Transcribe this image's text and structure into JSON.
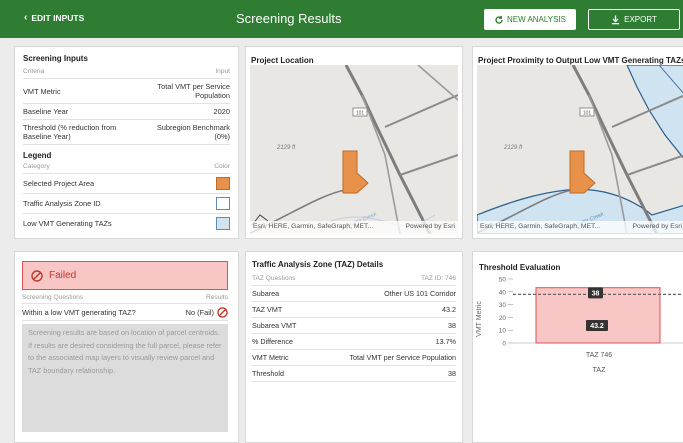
{
  "header": {
    "back_label": "EDIT INPUTS",
    "title": "Screening Results",
    "new_analysis_label": "NEW ANALYSIS",
    "export_label": "EXPORT"
  },
  "screening_inputs": {
    "title": "Screening Inputs",
    "col_criteria": "Criteria",
    "col_input": "Input",
    "rows": [
      {
        "label": "VMT Metric",
        "value": "Total VMT per Service Population"
      },
      {
        "label": "Baseline Year",
        "value": "2020"
      },
      {
        "label": "Threshold (% reduction from Baseline Year)",
        "value": "Subregion Benchmark (0%)"
      }
    ]
  },
  "legend": {
    "title": "Legend",
    "col_category": "Category",
    "col_color": "Color",
    "items": [
      {
        "label": "Selected Project Area",
        "color": "#e8914a"
      },
      {
        "label": "Traffic Analysis Zone ID",
        "color": "#ffffff"
      },
      {
        "label": "Low VMT Generating TAZs",
        "color": "#cfe3f1"
      }
    ]
  },
  "map1": {
    "title": "Project Location",
    "elevation": "2129 ft",
    "route": "101",
    "creek": "Mettin Creek",
    "attribution": "Esri, HERE, Garmin, SafeGraph, MET...",
    "powered": "Powered by Esri"
  },
  "map2": {
    "title": "Project Proximity to Output Low VMT Generating TAZs",
    "elevation": "2129 ft",
    "route": "101",
    "creek": "Mettin Creek",
    "attribution": "Esri, HERE, Garmin, SafeGraph, MET...",
    "powered": "Powered by Esri"
  },
  "result": {
    "status": "Failed",
    "col_questions": "Screening Questions",
    "col_results": "Results",
    "question": "Within a low VMT generating TAZ?",
    "answer": "No (Fail)",
    "note": "Screening results are based on location of parcel centroids. If results are desired considering the full parcel, please refer to the associated map layers to visually review parcel and TAZ boundary relationship."
  },
  "taz": {
    "title": "Traffic Analysis Zone (TAZ) Details",
    "col_questions": "TAZ Questions",
    "taz_id": "TAZ ID: 746",
    "rows": [
      {
        "label": "Subarea",
        "value": "Other US 101 Corridor"
      },
      {
        "label": "TAZ VMT",
        "value": "43.2"
      },
      {
        "label": "Subarea VMT",
        "value": "38"
      },
      {
        "label": "% Difference",
        "value": "13.7%"
      },
      {
        "label": "VMT Metric",
        "value": "Total VMT per Service Population"
      },
      {
        "label": "Threshold",
        "value": "38"
      }
    ]
  },
  "chart_data": {
    "type": "bar",
    "title": "Threshold Evaluation",
    "categories": [
      "TAZ 746"
    ],
    "values": [
      43.2
    ],
    "threshold": 38,
    "threshold_label": "38",
    "value_label": "43.2",
    "xlabel": "TAZ",
    "ylabel": "VMT Metric",
    "ylim": [
      0,
      50
    ],
    "yticks": [
      "50",
      "40",
      "30",
      "20",
      "10",
      "0"
    ],
    "colors": {
      "bar": "#f7c6c5",
      "bar_border": "#d9534f"
    }
  }
}
